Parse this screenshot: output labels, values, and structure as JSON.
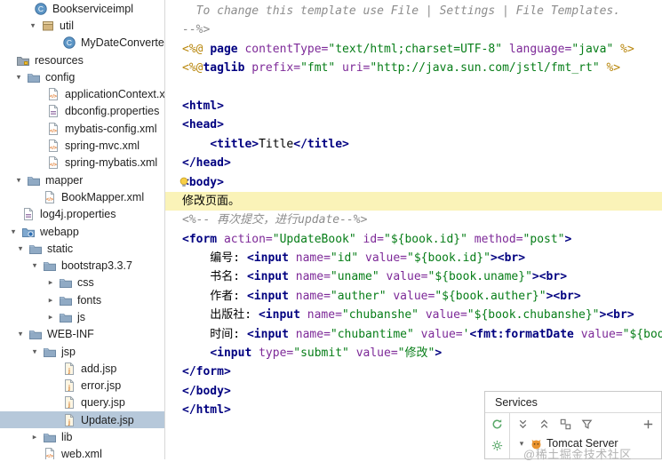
{
  "colors": {
    "selection": "#b6c8da",
    "line_highlight": "#faf3b8",
    "tag": "#000080",
    "attr": "#7d2998",
    "string": "#067d17",
    "comment": "#8c8c8c",
    "directive": "#b8860b",
    "plain": "#000000",
    "accent_green": "#59a869",
    "tomcat_orange": "#e9932f",
    "watermark_gray": "#b3b3b3"
  },
  "tree": {
    "items": [
      {
        "label": "Bookserviceimpl",
        "icon": "class",
        "indent": 38
      },
      {
        "label": "util",
        "icon": "package",
        "indent": 46,
        "chevron": "open"
      },
      {
        "label": "MyDateConverter",
        "icon": "class",
        "indent": 70
      },
      {
        "label": "resources",
        "icon": "resources-folder",
        "indent": 18
      },
      {
        "label": "config",
        "icon": "folder",
        "indent": 30,
        "chevron": "open"
      },
      {
        "label": "applicationContext.x...",
        "icon": "xml-file",
        "indent": 52
      },
      {
        "label": "dbconfig.properties",
        "icon": "properties-file",
        "indent": 52
      },
      {
        "label": "mybatis-config.xml",
        "icon": "xml-file",
        "indent": 52
      },
      {
        "label": "spring-mvc.xml",
        "icon": "xml-file",
        "indent": 52
      },
      {
        "label": "spring-mybatis.xml",
        "icon": "xml-file",
        "indent": 52
      },
      {
        "label": "mapper",
        "icon": "folder",
        "indent": 30,
        "chevron": "open"
      },
      {
        "label": "BookMapper.xml",
        "icon": "xml-file",
        "indent": 48
      },
      {
        "label": "log4j.properties",
        "icon": "properties-file",
        "indent": 24
      },
      {
        "label": "webapp",
        "icon": "web-folder",
        "indent": 24,
        "chevron": "open"
      },
      {
        "label": "static",
        "icon": "folder",
        "indent": 32,
        "chevron": "open"
      },
      {
        "label": "bootstrap3.3.7",
        "icon": "folder",
        "indent": 48,
        "chevron": "open"
      },
      {
        "label": "css",
        "icon": "folder",
        "indent": 66,
        "chevron": "closed"
      },
      {
        "label": "fonts",
        "icon": "folder",
        "indent": 66,
        "chevron": "closed"
      },
      {
        "label": "js",
        "icon": "folder",
        "indent": 66,
        "chevron": "closed"
      },
      {
        "label": "WEB-INF",
        "icon": "folder",
        "indent": 32,
        "chevron": "open"
      },
      {
        "label": "jsp",
        "icon": "folder",
        "indent": 48,
        "chevron": "open"
      },
      {
        "label": "add.jsp",
        "icon": "jsp-file",
        "indent": 70
      },
      {
        "label": "error.jsp",
        "icon": "jsp-file",
        "indent": 70
      },
      {
        "label": "query.jsp",
        "icon": "jsp-file",
        "indent": 70
      },
      {
        "label": "Update.jsp",
        "icon": "jsp-file",
        "indent": 70,
        "selected": true
      },
      {
        "label": "lib",
        "icon": "folder",
        "indent": 48,
        "chevron": "closed"
      },
      {
        "label": "web.xml",
        "icon": "xml-file",
        "indent": 48
      }
    ]
  },
  "editor": {
    "bulb_line_index": 9,
    "lines": [
      {
        "hl": false,
        "segs": [
          {
            "t": "  To change this template use File | Settings | File Templates.",
            "c": "cm"
          }
        ]
      },
      {
        "hl": false,
        "segs": [
          {
            "t": "--%>",
            "c": "cm"
          }
        ]
      },
      {
        "hl": false,
        "segs": [
          {
            "t": "<%@ ",
            "c": "dir"
          },
          {
            "t": "page ",
            "c": "tag"
          },
          {
            "t": "contentType=",
            "c": "attr"
          },
          {
            "t": "\"text/html;charset=UTF-8\"",
            "c": "str"
          },
          {
            "t": " ",
            "c": "pl"
          },
          {
            "t": "language=",
            "c": "attr"
          },
          {
            "t": "\"java\"",
            "c": "str"
          },
          {
            "t": " ",
            "c": "pl"
          },
          {
            "t": "%>",
            "c": "dir"
          }
        ]
      },
      {
        "hl": false,
        "segs": [
          {
            "t": "<%@",
            "c": "dir"
          },
          {
            "t": "taglib ",
            "c": "tag"
          },
          {
            "t": "prefix=",
            "c": "attr"
          },
          {
            "t": "\"fmt\"",
            "c": "str"
          },
          {
            "t": " ",
            "c": "pl"
          },
          {
            "t": "uri=",
            "c": "attr"
          },
          {
            "t": "\"http://java.sun.com/jstl/fmt_rt\"",
            "c": "str"
          },
          {
            "t": " ",
            "c": "pl"
          },
          {
            "t": "%>",
            "c": "dir"
          }
        ]
      },
      {
        "hl": false,
        "segs": []
      },
      {
        "hl": false,
        "segs": [
          {
            "t": "<html>",
            "c": "tag"
          }
        ]
      },
      {
        "hl": false,
        "segs": [
          {
            "t": "<head>",
            "c": "tag"
          }
        ]
      },
      {
        "hl": false,
        "segs": [
          {
            "t": "    ",
            "c": "pl"
          },
          {
            "t": "<title>",
            "c": "tag"
          },
          {
            "t": "Title",
            "c": "pl"
          },
          {
            "t": "</title>",
            "c": "tag"
          }
        ]
      },
      {
        "hl": false,
        "segs": [
          {
            "t": "</head>",
            "c": "tag"
          }
        ]
      },
      {
        "hl": false,
        "segs": [
          {
            "t": "<body>",
            "c": "tag"
          }
        ]
      },
      {
        "hl": true,
        "segs": [
          {
            "t": "修改页面。",
            "c": "pl"
          }
        ]
      },
      {
        "hl": false,
        "segs": [
          {
            "t": "<%-- 再次提交，进行update--%>",
            "c": "cm"
          }
        ]
      },
      {
        "hl": false,
        "segs": [
          {
            "t": "<form ",
            "c": "tag"
          },
          {
            "t": "action=",
            "c": "attr"
          },
          {
            "t": "\"UpdateBook\"",
            "c": "str"
          },
          {
            "t": " ",
            "c": "pl"
          },
          {
            "t": "id=",
            "c": "attr"
          },
          {
            "t": "\"${book.id}\"",
            "c": "str"
          },
          {
            "t": " ",
            "c": "pl"
          },
          {
            "t": "method=",
            "c": "attr"
          },
          {
            "t": "\"post\"",
            "c": "str"
          },
          {
            "t": ">",
            "c": "tag"
          }
        ]
      },
      {
        "hl": false,
        "segs": [
          {
            "t": "    编号: ",
            "c": "pl"
          },
          {
            "t": "<input ",
            "c": "tag"
          },
          {
            "t": "name=",
            "c": "attr"
          },
          {
            "t": "\"id\"",
            "c": "str"
          },
          {
            "t": " ",
            "c": "pl"
          },
          {
            "t": "value=",
            "c": "attr"
          },
          {
            "t": "\"${book.id}\"",
            "c": "str"
          },
          {
            "t": ">",
            "c": "tag"
          },
          {
            "t": "<br>",
            "c": "tag"
          }
        ]
      },
      {
        "hl": false,
        "segs": [
          {
            "t": "    书名: ",
            "c": "pl"
          },
          {
            "t": "<input ",
            "c": "tag"
          },
          {
            "t": "name=",
            "c": "attr"
          },
          {
            "t": "\"uname\"",
            "c": "str"
          },
          {
            "t": " ",
            "c": "pl"
          },
          {
            "t": "value=",
            "c": "attr"
          },
          {
            "t": "\"${book.uname}\"",
            "c": "str"
          },
          {
            "t": ">",
            "c": "tag"
          },
          {
            "t": "<br>",
            "c": "tag"
          }
        ]
      },
      {
        "hl": false,
        "segs": [
          {
            "t": "    作者: ",
            "c": "pl"
          },
          {
            "t": "<input ",
            "c": "tag"
          },
          {
            "t": "name=",
            "c": "attr"
          },
          {
            "t": "\"auther\"",
            "c": "str"
          },
          {
            "t": " ",
            "c": "pl"
          },
          {
            "t": "value=",
            "c": "attr"
          },
          {
            "t": "\"${book.auther}\"",
            "c": "str"
          },
          {
            "t": ">",
            "c": "tag"
          },
          {
            "t": "<br>",
            "c": "tag"
          }
        ]
      },
      {
        "hl": false,
        "segs": [
          {
            "t": "    出版社: ",
            "c": "pl"
          },
          {
            "t": "<input ",
            "c": "tag"
          },
          {
            "t": "name=",
            "c": "attr"
          },
          {
            "t": "\"chubanshe\"",
            "c": "str"
          },
          {
            "t": " ",
            "c": "pl"
          },
          {
            "t": "value=",
            "c": "attr"
          },
          {
            "t": "\"${book.chubanshe}\"",
            "c": "str"
          },
          {
            "t": ">",
            "c": "tag"
          },
          {
            "t": "<br>",
            "c": "tag"
          }
        ]
      },
      {
        "hl": false,
        "segs": [
          {
            "t": "    时间: ",
            "c": "pl"
          },
          {
            "t": "<input ",
            "c": "tag"
          },
          {
            "t": "name=",
            "c": "attr"
          },
          {
            "t": "\"chubantime\"",
            "c": "str"
          },
          {
            "t": " ",
            "c": "pl"
          },
          {
            "t": "value=",
            "c": "attr"
          },
          {
            "t": "'",
            "c": "str"
          },
          {
            "t": "<fmt:formatDate ",
            "c": "tag"
          },
          {
            "t": "value=",
            "c": "attr"
          },
          {
            "t": "\"${book",
            "c": "str"
          }
        ]
      },
      {
        "hl": false,
        "segs": [
          {
            "t": "    ",
            "c": "pl"
          },
          {
            "t": "<input ",
            "c": "tag"
          },
          {
            "t": "type=",
            "c": "attr"
          },
          {
            "t": "\"submit\"",
            "c": "str"
          },
          {
            "t": " ",
            "c": "pl"
          },
          {
            "t": "value=",
            "c": "attr"
          },
          {
            "t": "\"修改\"",
            "c": "str"
          },
          {
            "t": ">",
            "c": "tag"
          }
        ]
      },
      {
        "hl": false,
        "segs": [
          {
            "t": "</form>",
            "c": "tag"
          }
        ]
      },
      {
        "hl": false,
        "segs": [
          {
            "t": "</body>",
            "c": "tag"
          }
        ]
      },
      {
        "hl": false,
        "segs": [
          {
            "t": "</html>",
            "c": "tag"
          }
        ]
      }
    ]
  },
  "services": {
    "title": "Services",
    "left_toolbar_icons": [
      "refresh",
      "settings"
    ],
    "toolbar_icons": [
      "expand-all",
      "collapse-all",
      "group-by",
      "filter",
      "add"
    ],
    "server": {
      "label": "Tomcat Server",
      "icon": "tomcat",
      "chevron": "open"
    }
  },
  "watermark": {
    "text": "@稀土掘金技术社区"
  }
}
